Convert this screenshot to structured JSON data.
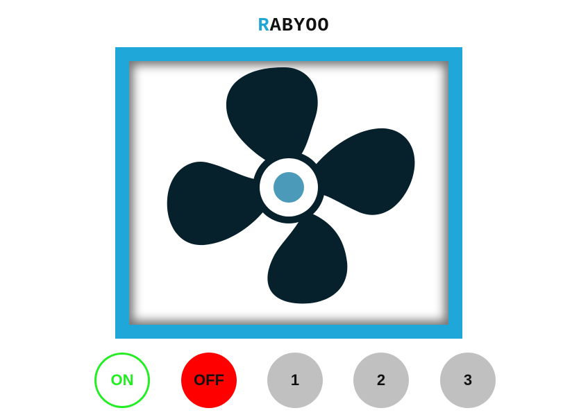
{
  "header": {
    "title_first_letter": "R",
    "title_rest": "ABYOO"
  },
  "display": {
    "icon": "fan-icon",
    "frame_color": "#1ea7d8",
    "blade_color": "#06202c",
    "hub_color": "#4b9ab9"
  },
  "controls": {
    "on_label": "ON",
    "off_label": "OFF",
    "speed_1_label": "1",
    "speed_2_label": "2",
    "speed_3_label": "3",
    "on_color": "#22ee22",
    "off_color": "#ff0000",
    "speed_color": "#c0c0c0"
  }
}
